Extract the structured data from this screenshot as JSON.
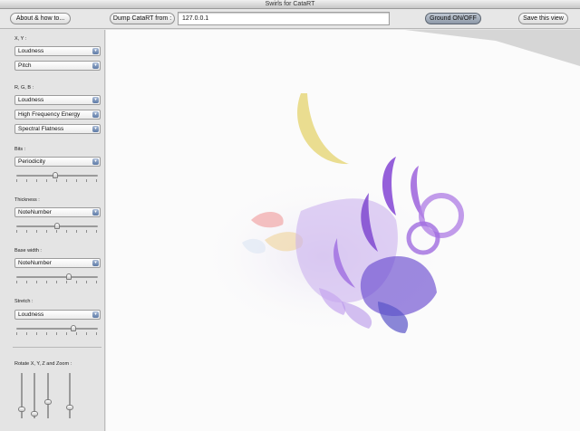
{
  "window": {
    "title": "Swirls for CataRT"
  },
  "toolbar": {
    "about_label": "About & how to...",
    "dump_label": "Dump CataRT from :",
    "ip_value": "127.0.0.1",
    "ground_label": "Ground ON/OFF",
    "save_label": "Save this view"
  },
  "sidebar": {
    "xy": {
      "label": "X, Y :",
      "selects": [
        "Loudness",
        "Pitch"
      ]
    },
    "rgb": {
      "label": "R, G, B :",
      "selects": [
        "Loudness",
        "High Frequency Energy",
        "Spectral Flatness"
      ]
    },
    "bits": {
      "label": "Bits :",
      "select": "Periodicity",
      "slider_value": 0.48
    },
    "thickness": {
      "label": "Thickness :",
      "select": "NoteNumber",
      "slider_value": 0.5
    },
    "base_width": {
      "label": "Base width :",
      "select": "NoteNumber",
      "slider_value": 0.65
    },
    "stretch": {
      "label": "Stretch :",
      "select": "Loudness",
      "slider_value": 0.72
    },
    "rotate": {
      "label": "Rotate X, Y, Z and Zoom :",
      "values": [
        0.15,
        0.05,
        0.35,
        0.2
      ]
    }
  },
  "colors": {
    "purple": "#8a4fd6",
    "violet": "#b58be8",
    "yellow": "#e8d77a",
    "pink": "#f0a6a6",
    "accent": "#5d7aa6"
  }
}
